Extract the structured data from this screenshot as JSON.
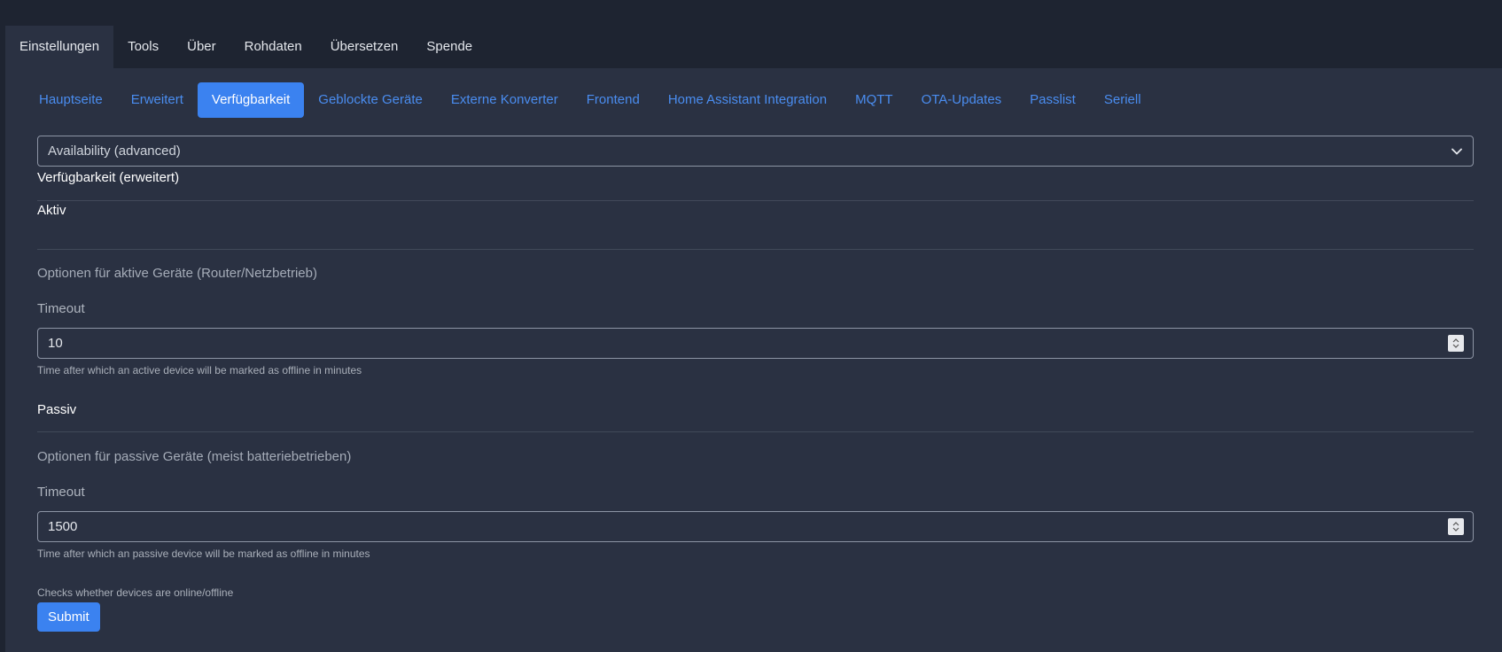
{
  "top_tabs": [
    {
      "label": "Einstellungen",
      "active": true
    },
    {
      "label": "Tools"
    },
    {
      "label": "Über"
    },
    {
      "label": "Rohdaten"
    },
    {
      "label": "Übersetzen"
    },
    {
      "label": "Spende"
    }
  ],
  "sub_tabs": [
    {
      "label": "Hauptseite"
    },
    {
      "label": "Erweitert"
    },
    {
      "label": "Verfügbarkeit",
      "active": true
    },
    {
      "label": "Geblockte Geräte"
    },
    {
      "label": "Externe Konverter"
    },
    {
      "label": "Frontend"
    },
    {
      "label": "Home Assistant Integration"
    },
    {
      "label": "MQTT"
    },
    {
      "label": "OTA-Updates"
    },
    {
      "label": "Passlist"
    },
    {
      "label": "Seriell"
    }
  ],
  "section_select": {
    "value": "Availability (advanced)"
  },
  "form": {
    "title": "Verfügbarkeit (erweitert)",
    "active": {
      "heading": "Aktiv",
      "description": "Optionen für aktive Geräte (Router/Netzbetrieb)",
      "timeout_label": "Timeout",
      "timeout_value": "10",
      "timeout_help": "Time after which an active device will be marked as offline in minutes"
    },
    "passive": {
      "heading": "Passiv",
      "description": "Optionen für passive Geräte (meist batteriebetrieben)",
      "timeout_label": "Timeout",
      "timeout_value": "1500",
      "timeout_help": "Time after which an passive device will be marked as offline in minutes"
    },
    "footer_help": "Checks whether devices are online/offline",
    "submit_label": "Submit"
  },
  "colors": {
    "accent": "#3b82f0",
    "link": "#4a8df0",
    "background": "#2a3142",
    "topbar": "#1e2431"
  }
}
